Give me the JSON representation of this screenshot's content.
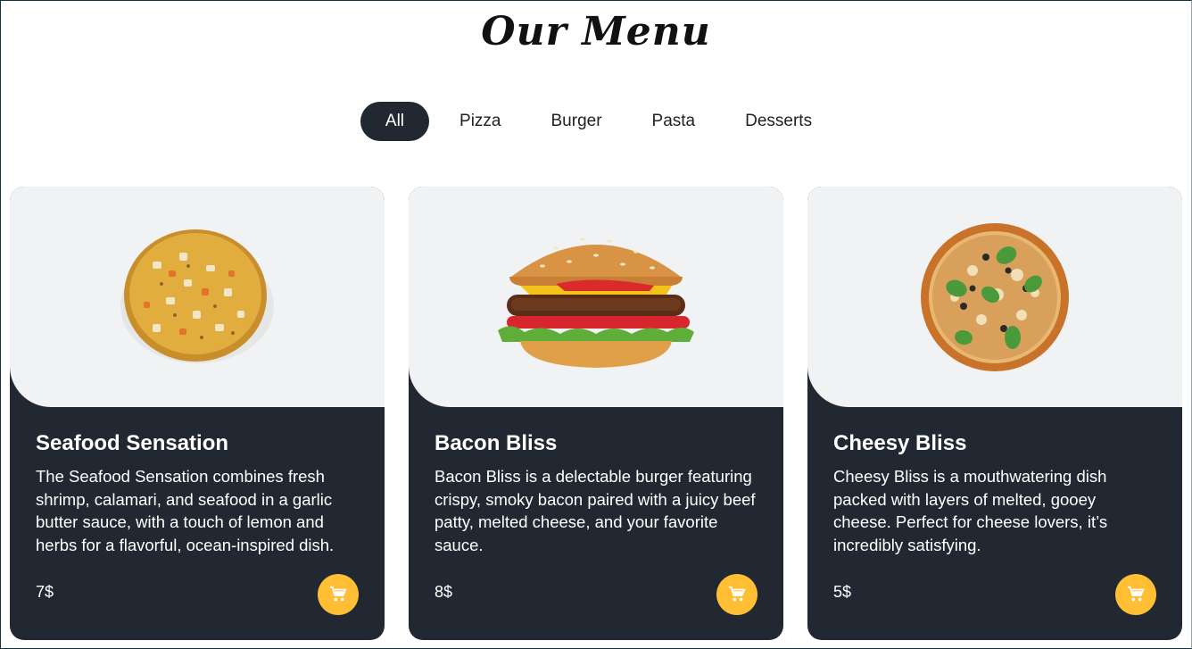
{
  "page": {
    "title": "Our Menu"
  },
  "filters": [
    {
      "label": "All",
      "active": true
    },
    {
      "label": "Pizza",
      "active": false
    },
    {
      "label": "Burger",
      "active": false
    },
    {
      "label": "Pasta",
      "active": false
    },
    {
      "label": "Desserts",
      "active": false
    }
  ],
  "cards": [
    {
      "name": "Seafood Sensation",
      "description": "The Seafood Sensation combines fresh shrimp, calamari, and seafood in a garlic butter sauce, with a touch of lemon and herbs for a flavorful, ocean-inspired dish.",
      "price": "7$",
      "image_icon": "seafood-pizza-image"
    },
    {
      "name": "Bacon Bliss",
      "description": "Bacon Bliss is a delectable burger featuring crispy, smoky bacon paired with a juicy beef patty, melted cheese, and your favorite sauce.",
      "price": "8$",
      "image_icon": "burger-image"
    },
    {
      "name": "Cheesy Bliss",
      "description": "Cheesy Bliss is a mouthwatering dish packed with layers of melted, gooey cheese. Perfect for cheese lovers, it’s incredibly satisfying.",
      "price": "5$",
      "image_icon": "cheese-pizza-image"
    }
  ],
  "colors": {
    "card_dark": "#222831",
    "card_media_bg": "#f1f2f3",
    "cart_button": "#ffbe33",
    "active_filter_bg": "#222831"
  },
  "icons": {
    "cart": "shopping-cart-icon"
  }
}
